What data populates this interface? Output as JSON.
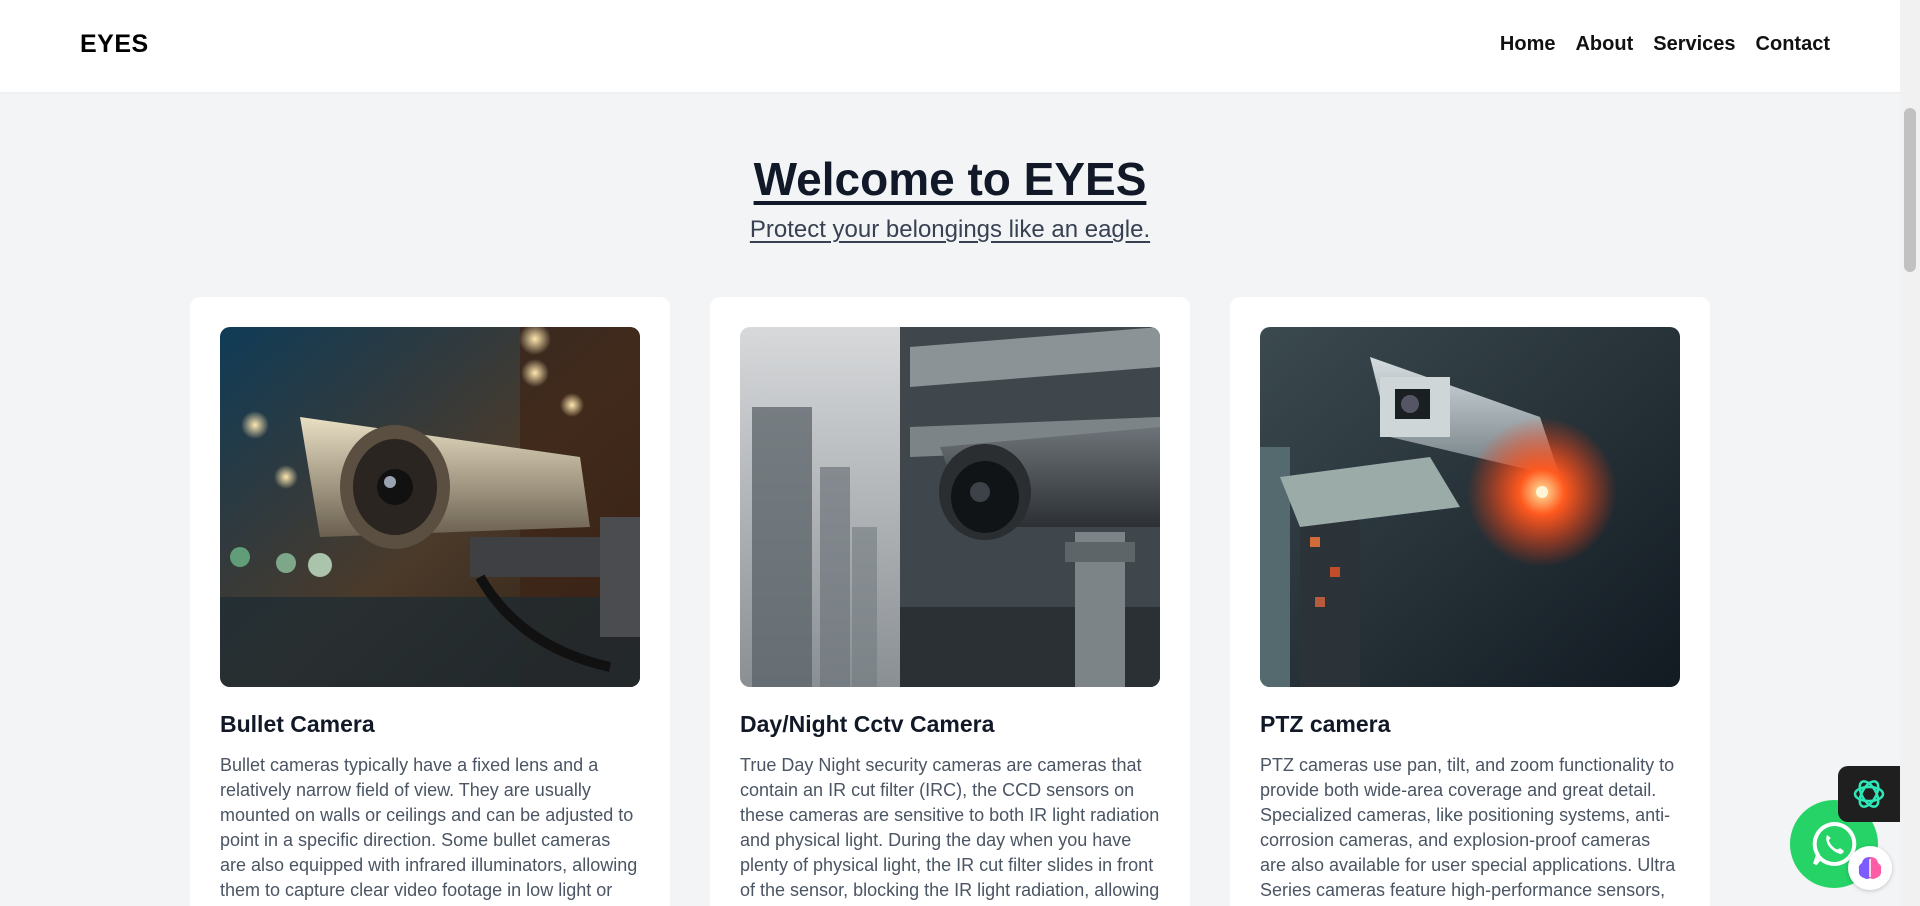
{
  "header": {
    "brand": "EYES",
    "nav": [
      {
        "label": "Home"
      },
      {
        "label": "About"
      },
      {
        "label": "Services"
      },
      {
        "label": "Contact"
      }
    ]
  },
  "hero": {
    "title": "Welcome to EYES",
    "subtitle": "Protect your belongings like an eagle."
  },
  "cards": [
    {
      "title": "Bullet Camera",
      "text": "Bullet cameras typically have a fixed lens and a relatively narrow field of view. They are usually mounted on walls or ceilings and can be adjusted to point in a specific direction. Some bullet cameras are also equipped with infrared illuminators, allowing them to capture clear video footage in low light or",
      "image_icon": "bullet-camera-photo"
    },
    {
      "title": "Day/Night Cctv Camera",
      "text": "True Day Night security cameras are cameras that contain an IR cut filter (IRC), the CCD sensors on these cameras are sensitive to both IR light radiation and physical light. During the day when you have plenty of physical light, the IR cut filter slides in front of the sensor, blocking the IR light radiation, allowing only",
      "image_icon": "dome-camera-photo"
    },
    {
      "title": "PTZ camera",
      "text": "PTZ cameras use pan, tilt, and zoom functionality to provide both wide-area coverage and great detail. Specialized cameras, like positioning systems, anti-corrosion cameras, and explosion-proof cameras are also available for user special applications. Ultra Series cameras feature high-performance sensors, powerful",
      "image_icon": "ptz-camera-photo"
    }
  ],
  "widgets": {
    "whatsapp_icon": "whatsapp-icon",
    "ai_icon": "openai-icon",
    "brain_icon": "brain-icon"
  },
  "colors": {
    "background": "#f3f4f6",
    "whatsapp": "#25d366",
    "card": "#ffffff"
  }
}
